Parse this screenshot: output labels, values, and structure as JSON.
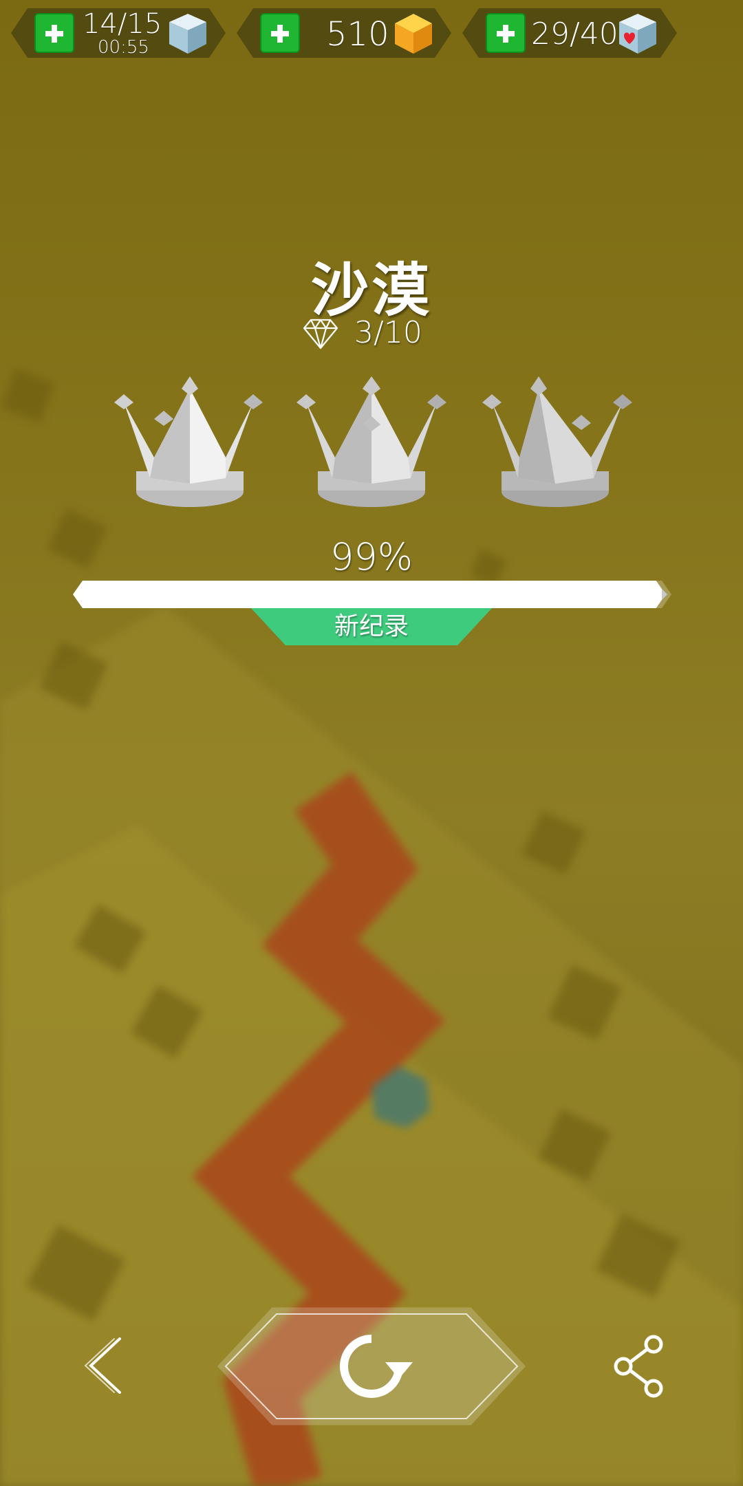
{
  "hud": {
    "lives": {
      "count": "14/15",
      "timer": "00:55"
    },
    "gems": {
      "count": "510"
    },
    "hearts": {
      "count": "29/40"
    }
  },
  "level": {
    "name": "沙漠",
    "diamonds": "3/10",
    "crowns_earned": 0,
    "crowns_total": 3
  },
  "progress": {
    "percent_label": "99%",
    "value": 0.99
  },
  "record_badge": "新纪录",
  "colors": {
    "background": "#85741a",
    "path": "#a84a1c",
    "hud_pill": "#4e4510",
    "plus_green": "#1fb632",
    "record_green": "#3ecb7e",
    "crown_silver": "#d8d8d8"
  },
  "controls": {
    "back": "chevron-left-icon",
    "replay": "replay-icon",
    "share": "share-icon"
  }
}
